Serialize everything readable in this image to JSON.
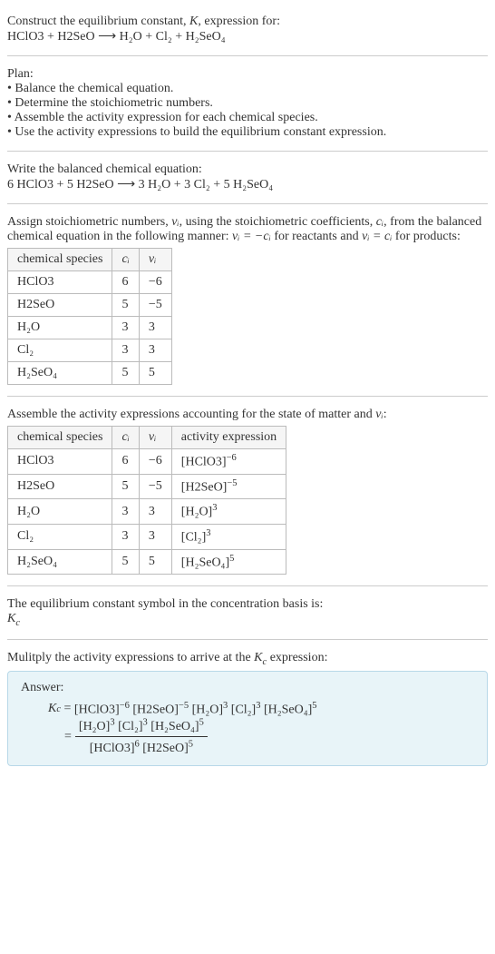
{
  "header": {
    "line1_prefix": "Construct the equilibrium constant, ",
    "line1_k": "K",
    "line1_suffix": ", expression for:",
    "equation": "HClO3 + H2SeO ⟶ H₂O + Cl₂ + H₂SeO₄"
  },
  "plan": {
    "title": "Plan:",
    "bullet1": "• Balance the chemical equation.",
    "bullet2": "• Determine the stoichiometric numbers.",
    "bullet3": "• Assemble the activity expression for each chemical species.",
    "bullet4": "• Use the activity expressions to build the equilibrium constant expression."
  },
  "balanced": {
    "intro": "Write the balanced chemical equation:",
    "equation": "6 HClO3 + 5 H2SeO ⟶ 3 H₂O + 3 Cl₂ + 5 H₂SeO₄"
  },
  "stoich": {
    "intro_p1": "Assign stoichiometric numbers, ",
    "nu_i": "νᵢ",
    "intro_p2": ", using the stoichiometric coefficients, ",
    "c_i": "cᵢ",
    "intro_p3": ", from the balanced chemical equation in the following manner: ",
    "rel1": "νᵢ = −cᵢ",
    "intro_p4": " for reactants and ",
    "rel2": "νᵢ = cᵢ",
    "intro_p5": " for products:",
    "table": {
      "h1": "chemical species",
      "h2": "cᵢ",
      "h3": "νᵢ",
      "rows": [
        {
          "sp": "HClO3",
          "c": "6",
          "v": "−6"
        },
        {
          "sp": "H2SeO",
          "c": "5",
          "v": "−5"
        },
        {
          "sp": "H₂O",
          "c": "3",
          "v": "3"
        },
        {
          "sp": "Cl₂",
          "c": "3",
          "v": "3"
        },
        {
          "sp": "H₂SeO₄",
          "c": "5",
          "v": "5"
        }
      ]
    }
  },
  "activity": {
    "intro_p1": "Assemble the activity expressions accounting for the state of matter and ",
    "nu_i": "νᵢ",
    "intro_p2": ":",
    "table": {
      "h1": "chemical species",
      "h2": "cᵢ",
      "h3": "νᵢ",
      "h4": "activity expression",
      "rows": [
        {
          "sp": "HClO3",
          "c": "6",
          "v": "−6",
          "ae_base": "[HClO3]",
          "ae_exp": "−6"
        },
        {
          "sp": "H2SeO",
          "c": "5",
          "v": "−5",
          "ae_base": "[H2SeO]",
          "ae_exp": "−5"
        },
        {
          "sp": "H₂O",
          "c": "3",
          "v": "3",
          "ae_base": "[H₂O]",
          "ae_exp": "3"
        },
        {
          "sp": "Cl₂",
          "c": "3",
          "v": "3",
          "ae_base": "[Cl₂]",
          "ae_exp": "3"
        },
        {
          "sp": "H₂SeO₄",
          "c": "5",
          "v": "5",
          "ae_base": "[H₂SeO₄]",
          "ae_exp": "5"
        }
      ]
    }
  },
  "symbol": {
    "line1": "The equilibrium constant symbol in the concentration basis is:",
    "kc_k": "K",
    "kc_c": "c"
  },
  "multiply": {
    "intro_p1": "Mulitply the activity expressions to arrive at the ",
    "kc_k": "K",
    "kc_c": "c",
    "intro_p2": " expression:"
  },
  "answer": {
    "label": "Answer:",
    "kc_eq": "Kc = ",
    "terms": [
      {
        "base": "[HClO3]",
        "exp": "−6"
      },
      {
        "base": "[H2SeO]",
        "exp": "−5"
      },
      {
        "base": "[H₂O]",
        "exp": "3"
      },
      {
        "base": "[Cl₂]",
        "exp": "3"
      },
      {
        "base": "[H₂SeO₄]",
        "exp": "5"
      }
    ],
    "eq_sign": "= ",
    "num_terms": [
      {
        "base": "[H₂O]",
        "exp": "3"
      },
      {
        "base": "[Cl₂]",
        "exp": "3"
      },
      {
        "base": "[H₂SeO₄]",
        "exp": "5"
      }
    ],
    "den_terms": [
      {
        "base": "[HClO3]",
        "exp": "6"
      },
      {
        "base": "[H2SeO]",
        "exp": "5"
      }
    ]
  }
}
